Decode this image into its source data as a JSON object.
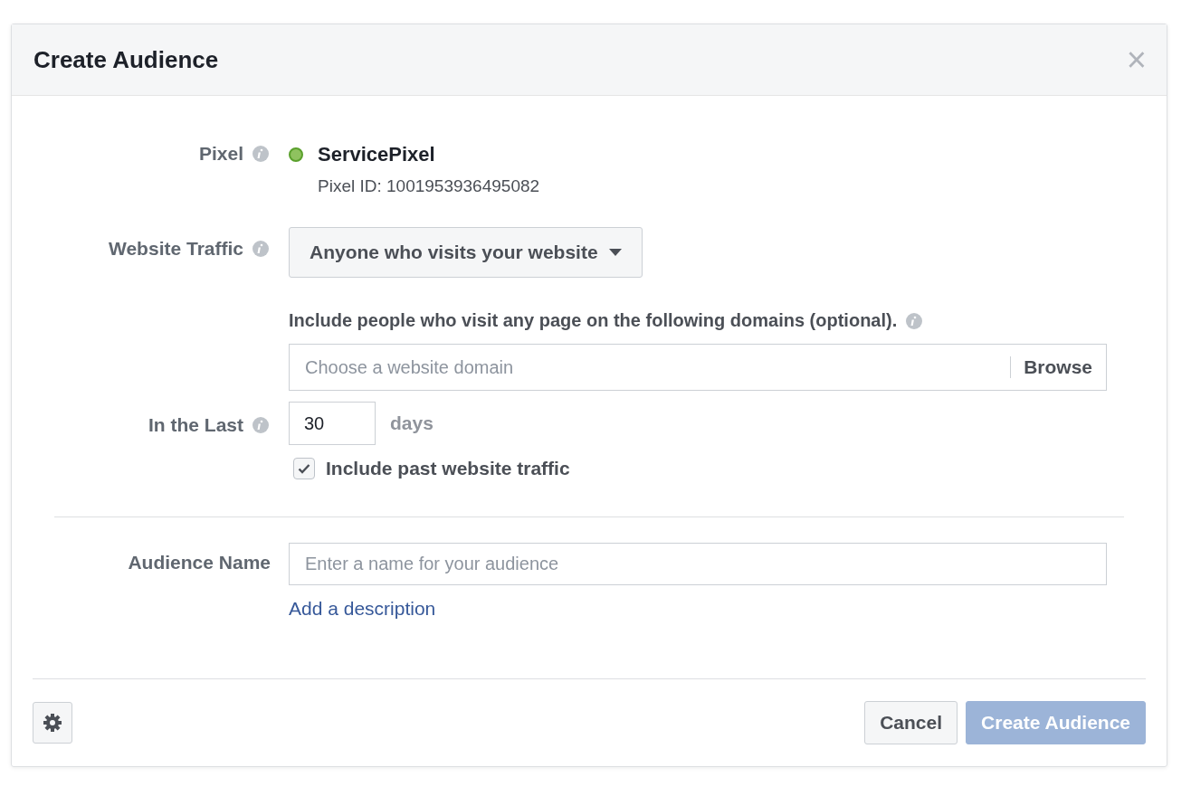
{
  "dialog": {
    "title": "Create Audience",
    "close": "×"
  },
  "pixel": {
    "label": "Pixel",
    "name": "ServicePixel",
    "active": true,
    "id_text": "Pixel ID: 1001953936495082"
  },
  "website_traffic": {
    "label": "Website Traffic",
    "value": "Anyone who visits your website"
  },
  "domains": {
    "label": "Include people who visit any page on the following domains (optional).",
    "placeholder": "Choose a website domain",
    "browse": "Browse"
  },
  "in_the_last": {
    "label": "In the Last",
    "value": "30",
    "unit": "days"
  },
  "past_traffic": {
    "label": "Include past website traffic",
    "checked": true
  },
  "audience_name": {
    "label": "Audience Name",
    "placeholder": "Enter a name for your audience",
    "link": "Add a description"
  },
  "buttons": [
    {
      "label": "Cancel",
      "kind": "secondary",
      "disabled": false
    },
    {
      "label": "Create Audience",
      "kind": "primary",
      "disabled": true
    }
  ]
}
